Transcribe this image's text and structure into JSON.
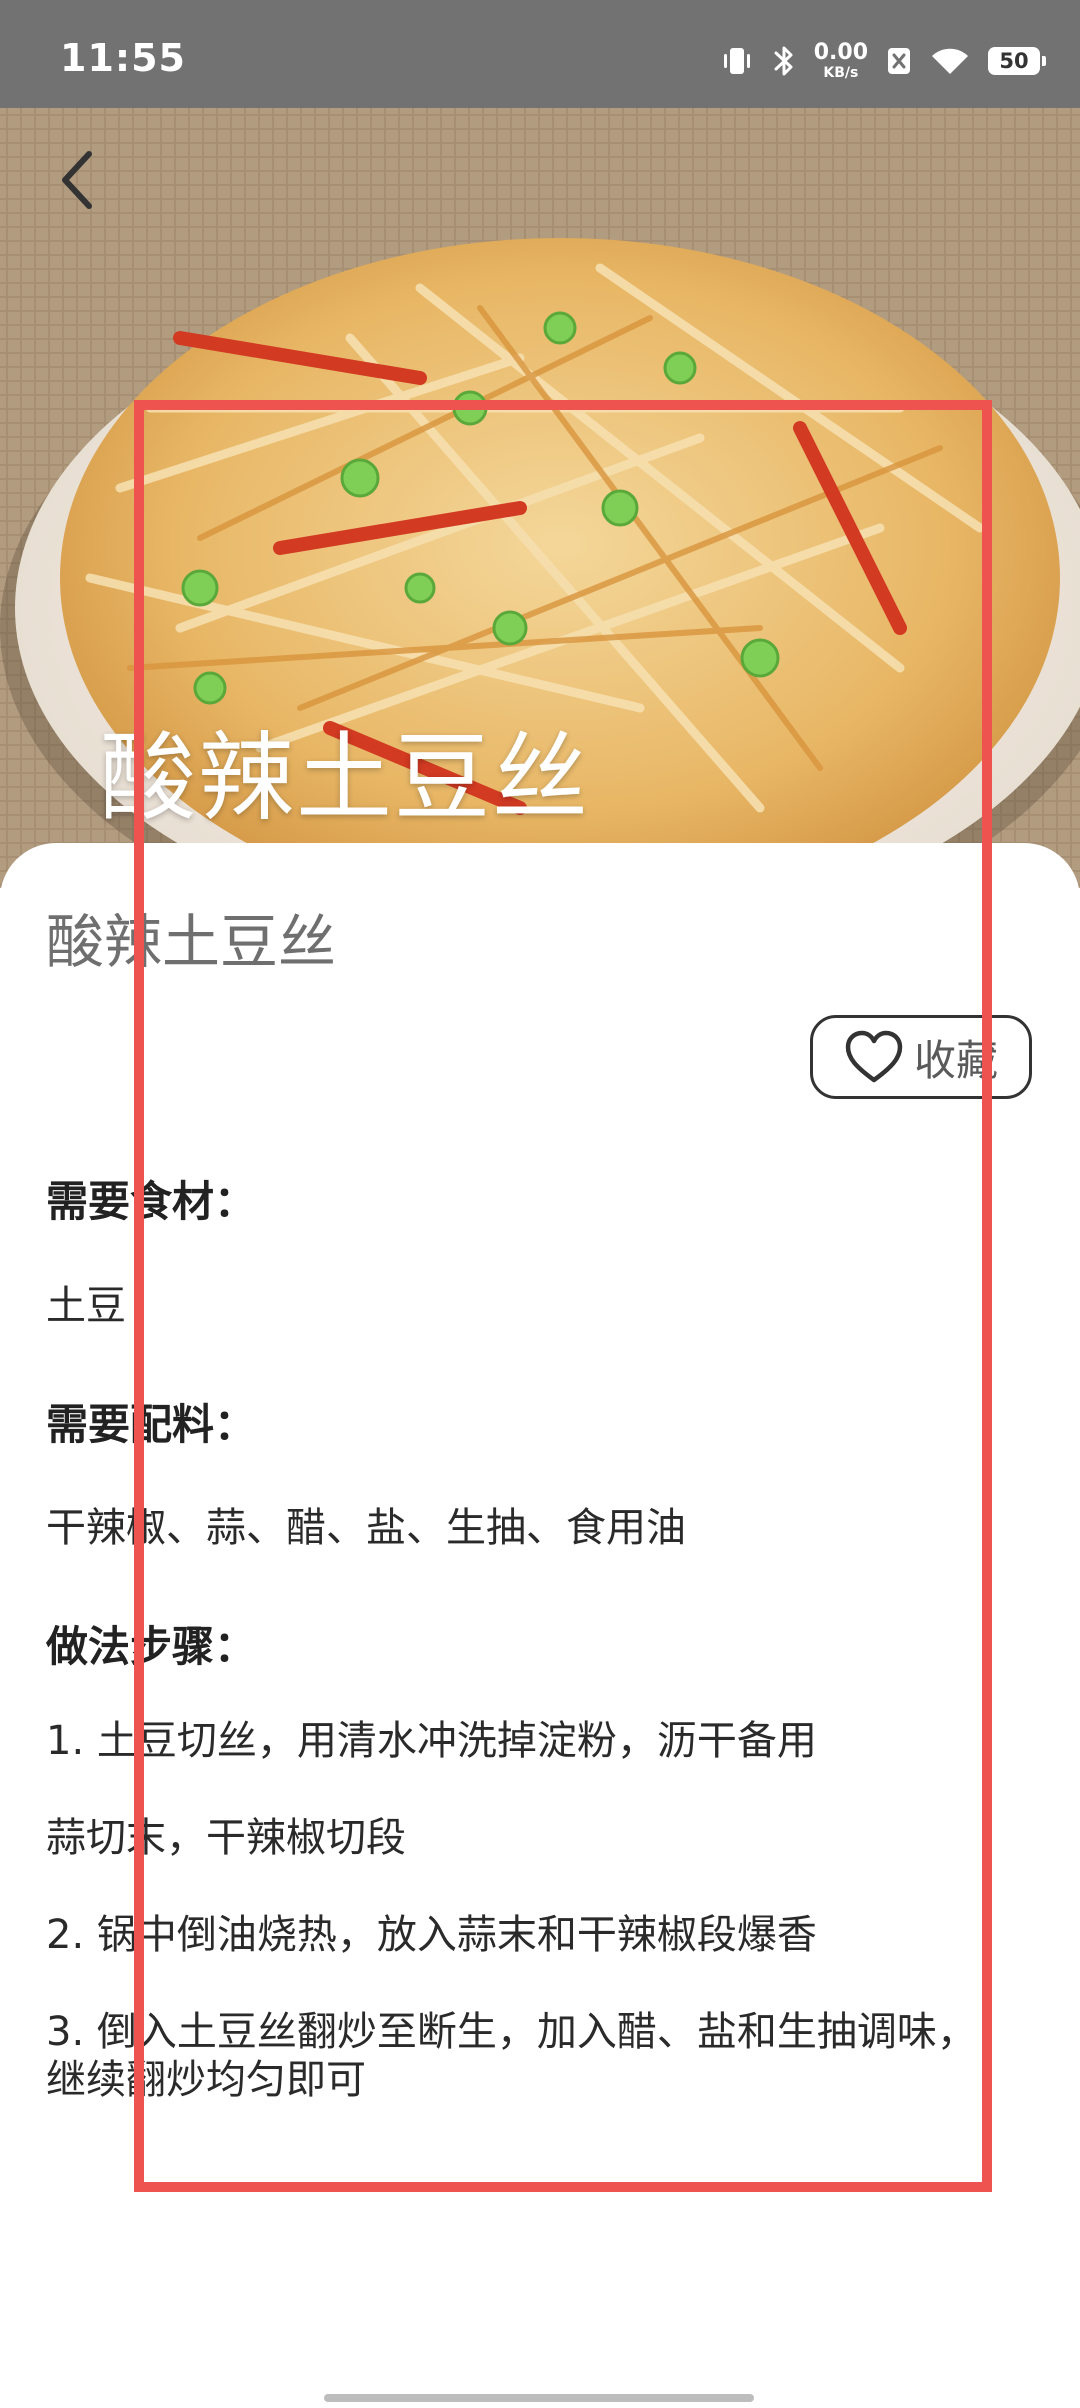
{
  "status_bar": {
    "time": "11:55",
    "net_speed_value": "0.00",
    "net_speed_unit": "KB/s",
    "battery_level": "50"
  },
  "hero": {
    "title": "酸辣土豆丝"
  },
  "recipe": {
    "name": "酸辣土豆丝",
    "favorite_label": "收藏",
    "ingredients_title": "需要食材：",
    "ingredients_text": "土豆",
    "seasonings_title": "需要配料：",
    "seasonings_text": "干辣椒、蒜、醋、盐、生抽、食用油",
    "steps_title": "做法步骤：",
    "steps": [
      "1. 土豆切丝，用清水冲洗掉淀粉，沥干备用",
      "蒜切末，干辣椒切段",
      "2. 锅中倒油烧热，放入蒜末和干辣椒段爆香",
      "3. 倒入土豆丝翻炒至断生，加入醋、盐和生抽调味，",
      "继续翻炒均匀即可"
    ]
  },
  "colors": {
    "status_bar_bg": "#727272",
    "highlight": "#ef5350",
    "dish_name": "#6f6f6f"
  },
  "icons": {
    "back": "chevron-left-icon",
    "favorite": "heart-outline-icon",
    "vibrate": "vibrate-icon",
    "bluetooth": "bluetooth-icon",
    "wifi": "wifi-icon"
  }
}
